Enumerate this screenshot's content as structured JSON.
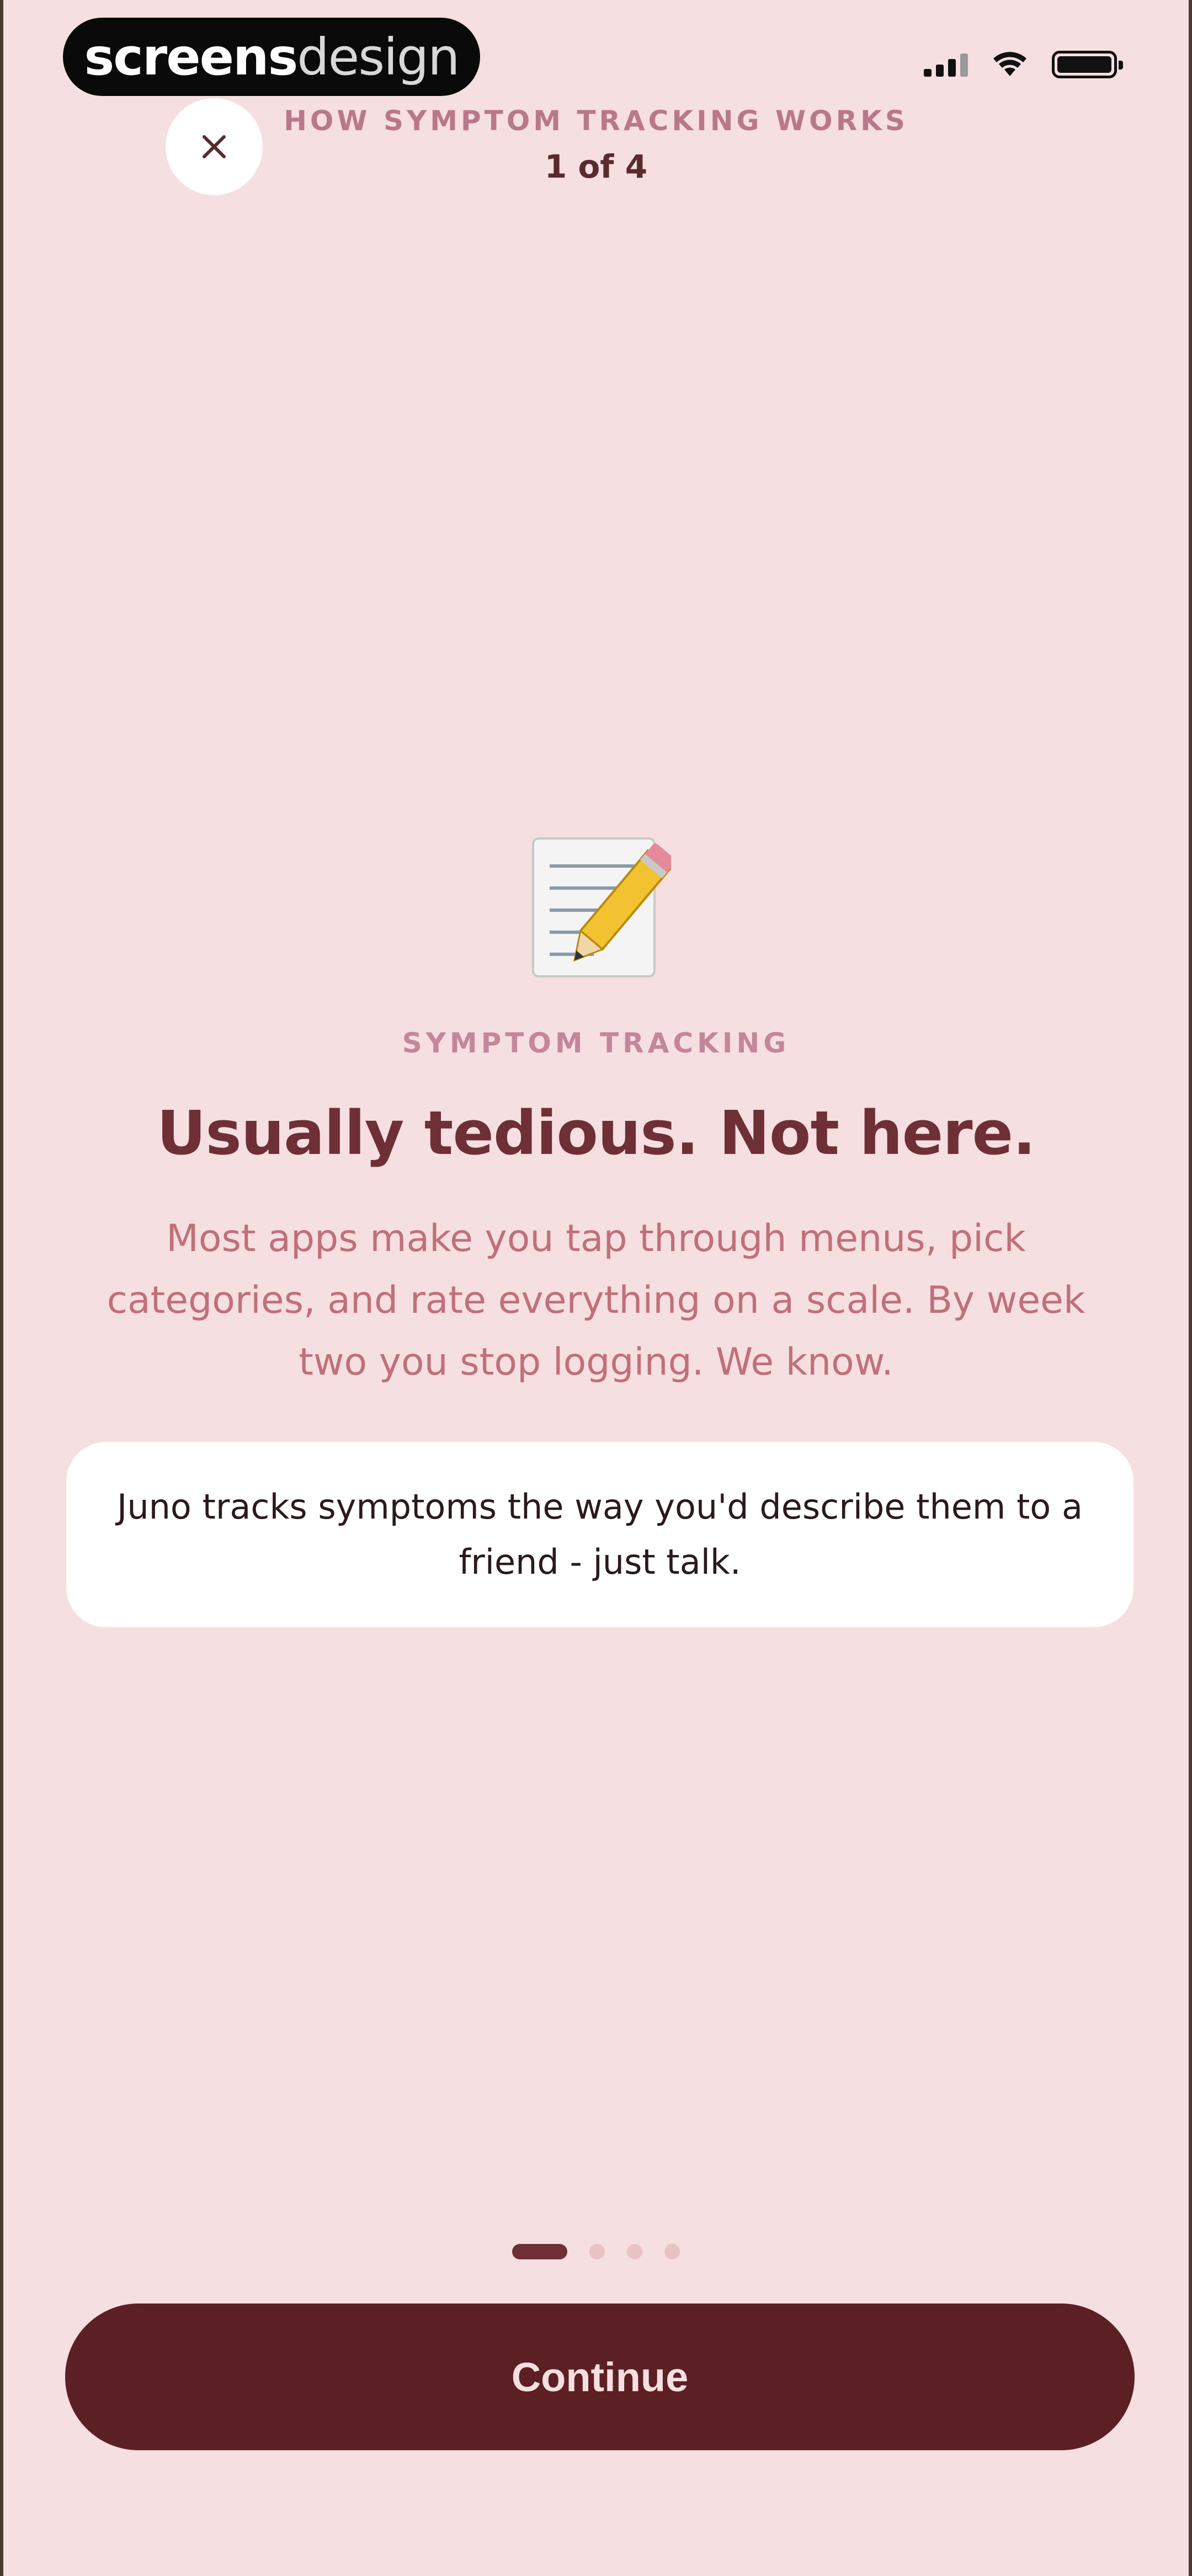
{
  "watermark": {
    "bold_part": "screens",
    "light_part": "design"
  },
  "status_bar": {
    "icons": [
      "signal-icon",
      "wifi-icon",
      "battery-icon"
    ]
  },
  "header": {
    "close_icon": "close-icon",
    "eyebrow": "HOW SYMPTOM TRACKING WORKS",
    "step": "1 of 4"
  },
  "main": {
    "hero_icon": "memo-pencil-icon",
    "eyebrow": "SYMPTOM TRACKING",
    "headline": "Usually tedious. Not here.",
    "body": "Most apps make you tap through menus, pick categories, and rate everything on a scale. By week two you stop logging. We know.",
    "callout": "Juno tracks symptoms the way you'd describe them to a friend - just talk."
  },
  "pager": {
    "total": 4,
    "current": 1
  },
  "footer": {
    "continue_label": "Continue"
  },
  "colors": {
    "background": "#f6dfe0",
    "primary": "#5c1f23",
    "headline": "#6e2f36",
    "body": "#c0707a"
  }
}
